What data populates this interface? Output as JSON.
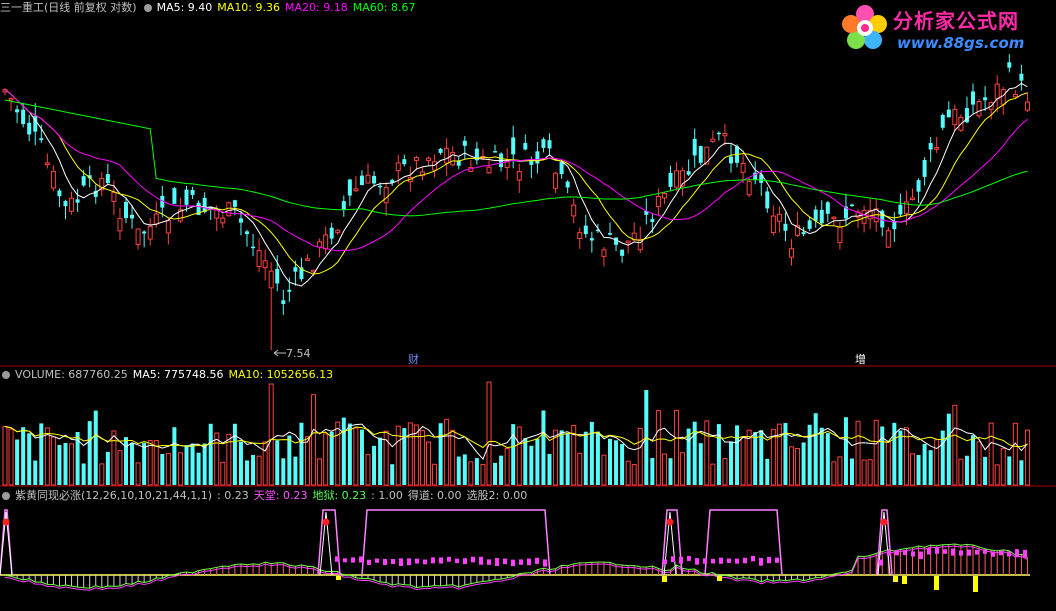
{
  "header": {
    "title": "三一重工(日线 前复权 对数)",
    "ma5": "MA5: 9.40",
    "ma10": "MA10: 9.36",
    "ma20": "MA20: 9.18",
    "ma60": "MA60: 8.67"
  },
  "volume_header": {
    "volume": "VOLUME: 687760.25",
    "ma5": "MA5: 775748.56",
    "ma10": "MA10: 1052656.13"
  },
  "indicator_header": {
    "name": "紫黄同现必涨(12,26,10,10,21,44,1,1)",
    "value": ": 0.23",
    "tiantang": "天堂: 0.23",
    "diyu": "地狱: 0.23",
    "third": ": 1.00",
    "dedao": "得道: 0.00",
    "xuangu": "选股2: 0.00"
  },
  "price_annotations": {
    "low_label": "7.54",
    "marker_cai": "财",
    "marker_zeng": "增"
  },
  "logo": {
    "title": "分析家公式网",
    "url": "www.88gs.com"
  },
  "colors": {
    "up": "#ff4040",
    "down": "#54fcfc",
    "ma5": "#ffffff",
    "ma10": "#ffff00",
    "ma20": "#ff00ff",
    "ma60": "#00ff00",
    "separator": "#b00000"
  }
}
